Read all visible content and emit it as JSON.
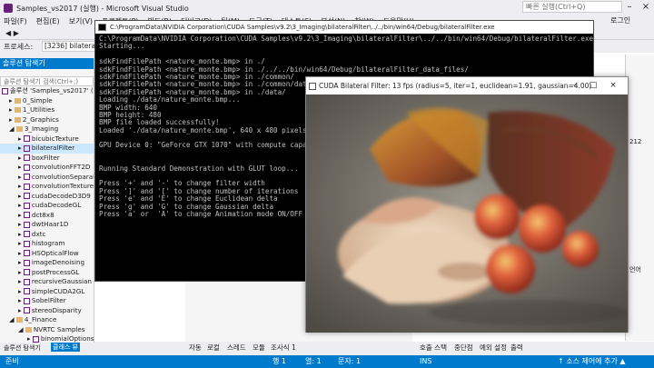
{
  "window": {
    "title": "Samples_vs2017 (실행) - Microsoft Visual Studio"
  },
  "menu": [
    "파일(F)",
    "편집(E)",
    "보기(V)",
    "프로젝트(P)",
    "빌드(B)",
    "디버그(D)",
    "팀(M)",
    "도구(T)",
    "테스트(S)",
    "분석(N)",
    "창(W)",
    "도움말(H)"
  ],
  "quick_launch": {
    "placeholder": "빠른 실행(Ctrl+Q)"
  },
  "login_label": "로그인",
  "process_label": "프로세스:",
  "process_value": "[3236] bilateralFilter",
  "solution_explorer": {
    "title": "솔루션 탐색기",
    "search_placeholder": "솔루션 탐색기 검색(Ctrl+;)",
    "items": [
      "솔루션 'Samples_vs2017' (16",
      "0_Simple",
      "1_Utilities",
      "2_Graphics",
      "3_Imaging",
      "bicubicTexture",
      "bilateralFilter",
      "boxFilter",
      "convolutionFFT2D",
      "convolutionSeparable",
      "convolutionTexture",
      "cudaDecodeD3D9",
      "cudaDecodeGL",
      "dct8x8",
      "dwtHaar1D",
      "dxtc",
      "histogram",
      "HSOpticalFlow",
      "imageDenoising",
      "postProcessGL",
      "recursiveGaussian",
      "simpleCUDA2GL",
      "SobelFilter",
      "stereoDisparity",
      "4_Finance",
      "NVRTC Samples",
      "binomialOptions_nvrtc"
    ],
    "tabs": [
      "솔루션 탐색기",
      "클래스 뷰"
    ]
  },
  "console": {
    "title": "C:\\ProgramData\\NVIDIA Corporation\\CUDA Samples\\v9.2\\3_Imaging\\bilateralFilter\\../../bin/win64/Debug/bilateralFilter.exe",
    "lines": [
      "C:\\ProgramData\\NVIDIA Corporation\\CUDA Samples\\v9.2\\3_Imaging\\bilateralFilter\\../../bin/win64/Debug/bilateralFilter.exe",
      "Starting...",
      "",
      "sdkFindFilePath <nature_monte.bmp> in ./",
      "sdkFindFilePath <nature_monte.bmp> in ./../../bin/win64/Debug/bilateralFilter_data_files/",
      "sdkFindFilePath <nature_monte.bmp> in ./common/",
      "sdkFindFilePath <nature_monte.bmp> in ./common/data/",
      "sdkFindFilePath <nature_monte.bmp> in ./data/",
      "Loading ./data/nature_monte.bmp...",
      "BMP width: 640",
      "BMP height: 480",
      "BMP file loaded successfully!",
      "Loaded './data/nature_monte.bmp', 640 x 480 pixels",
      "",
      "GPU Device 0: \"GeForce GTX 1070\" with compute capab",
      "",
      "",
      "Running Standard Demonstration with GLUT loop...",
      "",
      "Press '+' and '-' to change filter width",
      "Press ']' and '[' to change number of iterations",
      "Press 'e' and 'E' to change Euclidean delta",
      "Press 'g' and 'G' to change Gaussian delta",
      "Press 'a' or  'A' to change Animation mode ON/OFF"
    ]
  },
  "cuda_window": {
    "title": "CUDA Bilateral Filter:  13 fps (radius=5, iter=1, euclidean=1.91, gaussian=4.00)"
  },
  "right_panel": {
    "line1": "212",
    "line2": "언어"
  },
  "bottom_tabs": [
    "자동",
    "로컬",
    "스레드",
    "모듈",
    "조사식 1",
    "호출 스택",
    "중단점",
    "예외 설정",
    "출력"
  ],
  "status": {
    "ready": "준비",
    "line": "행 1",
    "col": "열: 1",
    "char": "문자: 1",
    "ins": "INS",
    "source_control": "↑ 소스 제어에 추가 ▲"
  },
  "colors": {
    "accent": "#007acc",
    "vs_purple": "#68217a"
  }
}
